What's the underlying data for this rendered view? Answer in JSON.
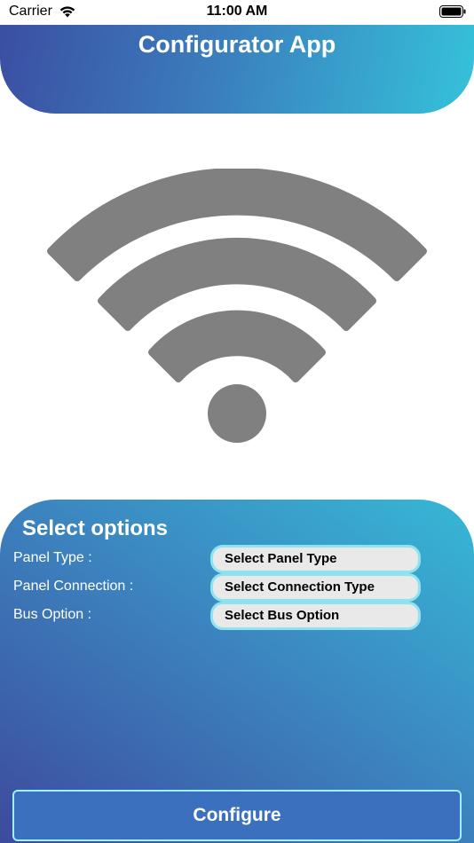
{
  "status_bar": {
    "carrier": "Carrier",
    "time": "11:00 AM"
  },
  "header": {
    "title": "Configurator App"
  },
  "options": {
    "title": "Select options",
    "rows": [
      {
        "label": "Panel Type :",
        "value": "Select Panel Type"
      },
      {
        "label": "Panel Connection :",
        "value": "Select Connection Type"
      },
      {
        "label": "Bus Option :",
        "value": "Select Bus Option"
      }
    ]
  },
  "configure_label": "Configure",
  "colors": {
    "gradient_start": "#3b4fa2",
    "gradient_end": "#35c2da",
    "wifi_icon": "#808080",
    "select_bg": "#e9e9e9",
    "select_border": "#8fe3ef"
  },
  "icons": {
    "hero": "wifi-icon",
    "status_signal": "wifi-icon",
    "status_battery": "battery-icon"
  }
}
